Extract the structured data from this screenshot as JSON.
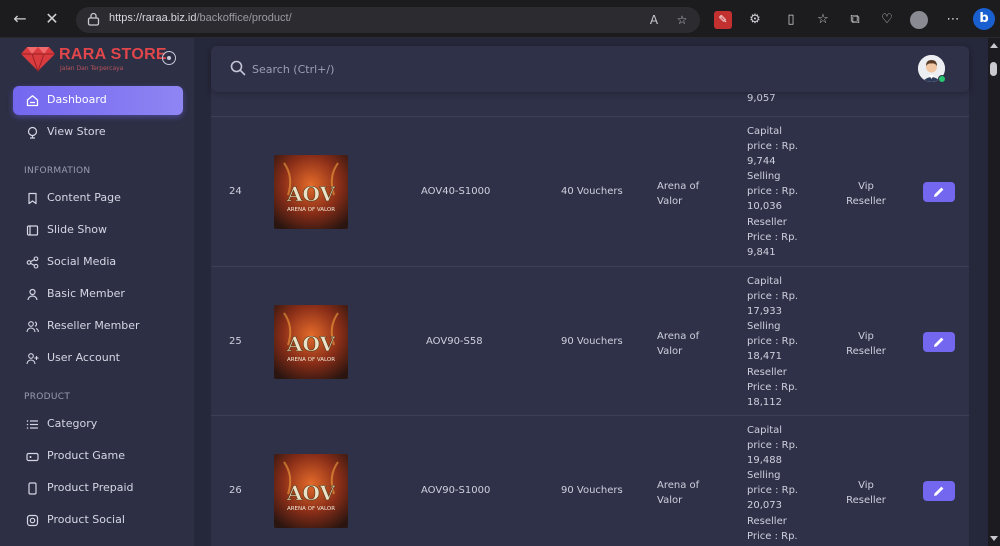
{
  "browser": {
    "url_host": "https://raraa.biz.id",
    "url_path": "/backoffice/product/"
  },
  "brand": {
    "name": "RARA STORE",
    "tagline": "Jalan Dan Terpercaya"
  },
  "sidebar": {
    "top_items": [
      {
        "label": "Dashboard",
        "icon": "home-icon",
        "active": true
      },
      {
        "label": "View Store",
        "icon": "globe-icon",
        "active": false
      }
    ],
    "sections": [
      {
        "title": "INFORMATION",
        "items": [
          {
            "label": "Content Page",
            "icon": "bookmark-icon"
          },
          {
            "label": "Slide Show",
            "icon": "slides-icon"
          },
          {
            "label": "Social Media",
            "icon": "share-icon"
          },
          {
            "label": "Basic Member",
            "icon": "user-icon"
          },
          {
            "label": "Reseller Member",
            "icon": "users-icon"
          },
          {
            "label": "User Account",
            "icon": "user-plus-icon"
          }
        ]
      },
      {
        "title": "PRODUCT",
        "items": [
          {
            "label": "Category",
            "icon": "list-icon"
          },
          {
            "label": "Product Game",
            "icon": "gamepad-icon"
          },
          {
            "label": "Product Prepaid",
            "icon": "phone-icon"
          },
          {
            "label": "Product Social",
            "icon": "instagram-icon"
          }
        ]
      }
    ]
  },
  "search": {
    "placeholder": "Search (Ctrl+/)"
  },
  "table": {
    "partial_top_value": "9,057",
    "rows": [
      {
        "no": "24",
        "image_alt": "Arena of Valor",
        "code": "AOV40-S1000",
        "name": "40 Vouchers",
        "game": "Arena of Valor",
        "price_lines": [
          "Capital",
          "price : Rp.",
          "9,744",
          "Selling",
          "price : Rp.",
          "10,036",
          "Reseller",
          "Price : Rp.",
          "9,841"
        ],
        "level": "Vip Reseller"
      },
      {
        "no": "25",
        "image_alt": "Arena of Valor",
        "code": "AOV90-S58",
        "name": "90 Vouchers",
        "game": "Arena of Valor",
        "price_lines": [
          "Capital",
          "price : Rp.",
          "17,933",
          "Selling",
          "price : Rp.",
          "18,471",
          "Reseller",
          "Price : Rp.",
          "18,112"
        ],
        "level": "Vip Reseller"
      },
      {
        "no": "26",
        "image_alt": "Arena of Valor",
        "code": "AOV90-S1000",
        "name": "90 Vouchers",
        "game": "Arena of Valor",
        "price_lines": [
          "Capital",
          "price : Rp.",
          "19,488",
          "Selling",
          "price : Rp.",
          "20,073",
          "Reseller",
          "Price : Rp."
        ],
        "level": "Vip Reseller"
      }
    ]
  },
  "colors": {
    "accent": "#7367f0",
    "sidebar_bg": "#2d2f45",
    "content_bg": "#25273a",
    "card_bg": "#2f3149",
    "brand_red": "#e1464a"
  },
  "aov_logo_text": "AOV",
  "aov_logo_sub": "ARENA OF VALOR"
}
